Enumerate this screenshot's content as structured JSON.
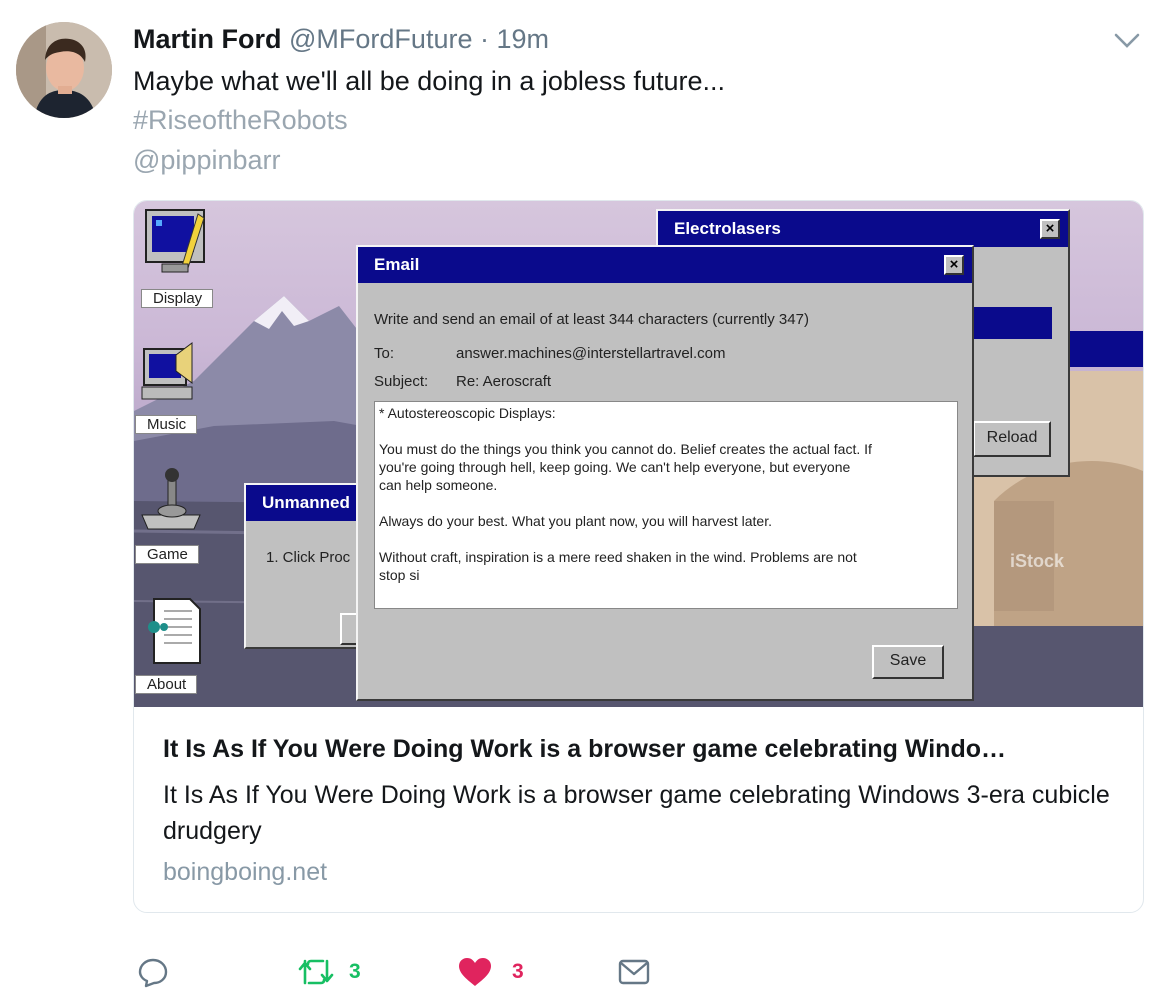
{
  "tweet": {
    "author_name": "Martin Ford",
    "author_handle": "@MFordFuture",
    "separator": "·",
    "time": "19m",
    "text": "Maybe what we'll all be doing in a jobless future...",
    "hashtag": "#RiseoftheRobots",
    "mention": "@pippinbarr"
  },
  "card": {
    "title": "It Is As If You Were Doing Work is a browser game celebrating Windo…",
    "description": "It Is As If You Were Doing Work is a browser game celebrating Windows 3-era cubicle drudgery",
    "domain": "boingboing.net",
    "screenshot": {
      "icons": [
        "Display",
        "Music",
        "Game",
        "About"
      ],
      "back_window": {
        "title": "Electrolasers",
        "button": "Reload"
      },
      "side_window": {
        "title": "Unmanned",
        "text": "1. Click Proc"
      },
      "email": {
        "title": "Email",
        "instruction": "Write and send an email of at least 344 characters (currently 347)",
        "to_label": "To:",
        "to_value": "answer.machines@interstellartravel.com",
        "subject_label": "Subject:",
        "subject_value": "Re: Aeroscraft",
        "body_lines": [
          "* Autostereoscopic Displays:",
          "",
          "You must do the things you think you cannot do. Belief creates the actual fact. If",
          "you're going through hell, keep going. We can't help everyone, but everyone",
          "can help someone.",
          "",
          "Always do your best. What you plant now, you will harvest later.",
          "",
          "Without craft, inspiration is a mere reed shaken in the wind. Problems are not",
          "stop si"
        ],
        "save_label": "Save"
      },
      "watermark": "iStock"
    }
  },
  "actions": {
    "retweet_count": "3",
    "like_count": "3"
  },
  "colors": {
    "link_gray": "#9aa6b0",
    "retweet_green": "#17bf63",
    "like_red": "#e0245e",
    "titlebar_blue": "#0a0a8c"
  }
}
